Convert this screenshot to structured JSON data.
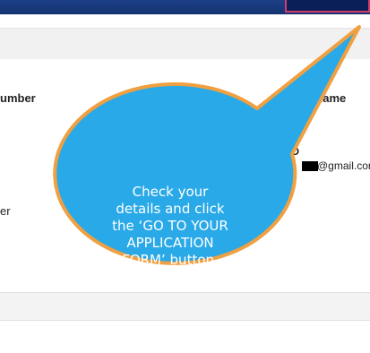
{
  "form": {
    "number_label": "umber",
    "name_label": "s Name",
    "id_label": "ID",
    "email_value": "@gmail.con",
    "left_fragment_label": "er"
  },
  "callout": {
    "lines": [
      "Check your",
      "details and click",
      "the ‘GO TO YOUR",
      "APPLICATION",
      "FORM’ button."
    ],
    "fill_color": "#29a9e8",
    "border_color": "#f0a040"
  }
}
